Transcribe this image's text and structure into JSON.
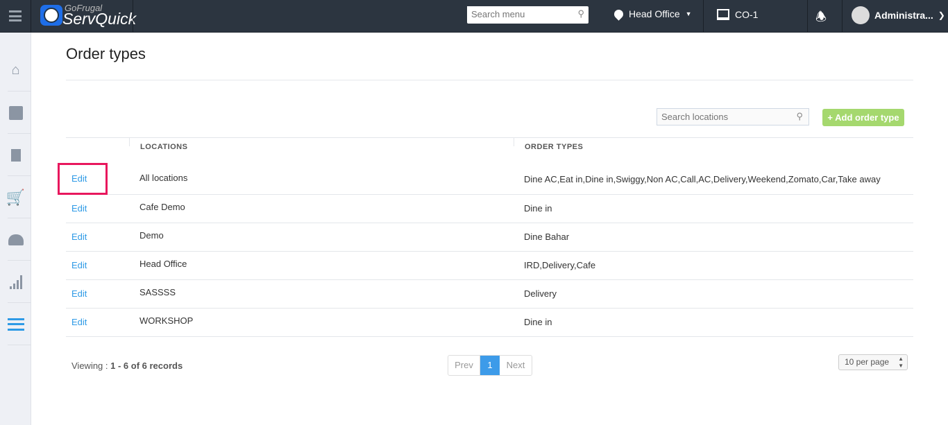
{
  "header": {
    "brand_top": "GoFrugal",
    "brand_name": "ServQuick",
    "search_placeholder": "Search menu",
    "location": "Head Office",
    "counter": "CO-1",
    "user": "Administra..."
  },
  "page": {
    "title": "Order types",
    "search_placeholder": "Search locations",
    "add_button": "+ Add order type"
  },
  "table": {
    "columns": [
      "LOCATIONS",
      "ORDER TYPES"
    ],
    "edit_label": "Edit",
    "rows": [
      {
        "location": "All locations",
        "order_types": "Dine AC,Eat in,Dine in,Swiggy,Non AC,Call,AC,Delivery,Weekend,Zomato,Car,Take away"
      },
      {
        "location": "Cafe Demo",
        "order_types": "Dine in"
      },
      {
        "location": "Demo",
        "order_types": "Dine Bahar"
      },
      {
        "location": "Head Office",
        "order_types": "IRD,Delivery,Cafe"
      },
      {
        "location": "SASSSS",
        "order_types": "Delivery"
      },
      {
        "location": "WORKSHOP",
        "order_types": "Dine in"
      }
    ]
  },
  "footer": {
    "viewing_prefix": "Viewing : ",
    "viewing_range": "1 - 6 of 6 records",
    "prev": "Prev",
    "page": "1",
    "next": "Next",
    "per_page": "10 per page"
  },
  "colors": {
    "accent": "#2e9ae6",
    "add": "#a5d86e",
    "highlight": "#e8175d"
  }
}
